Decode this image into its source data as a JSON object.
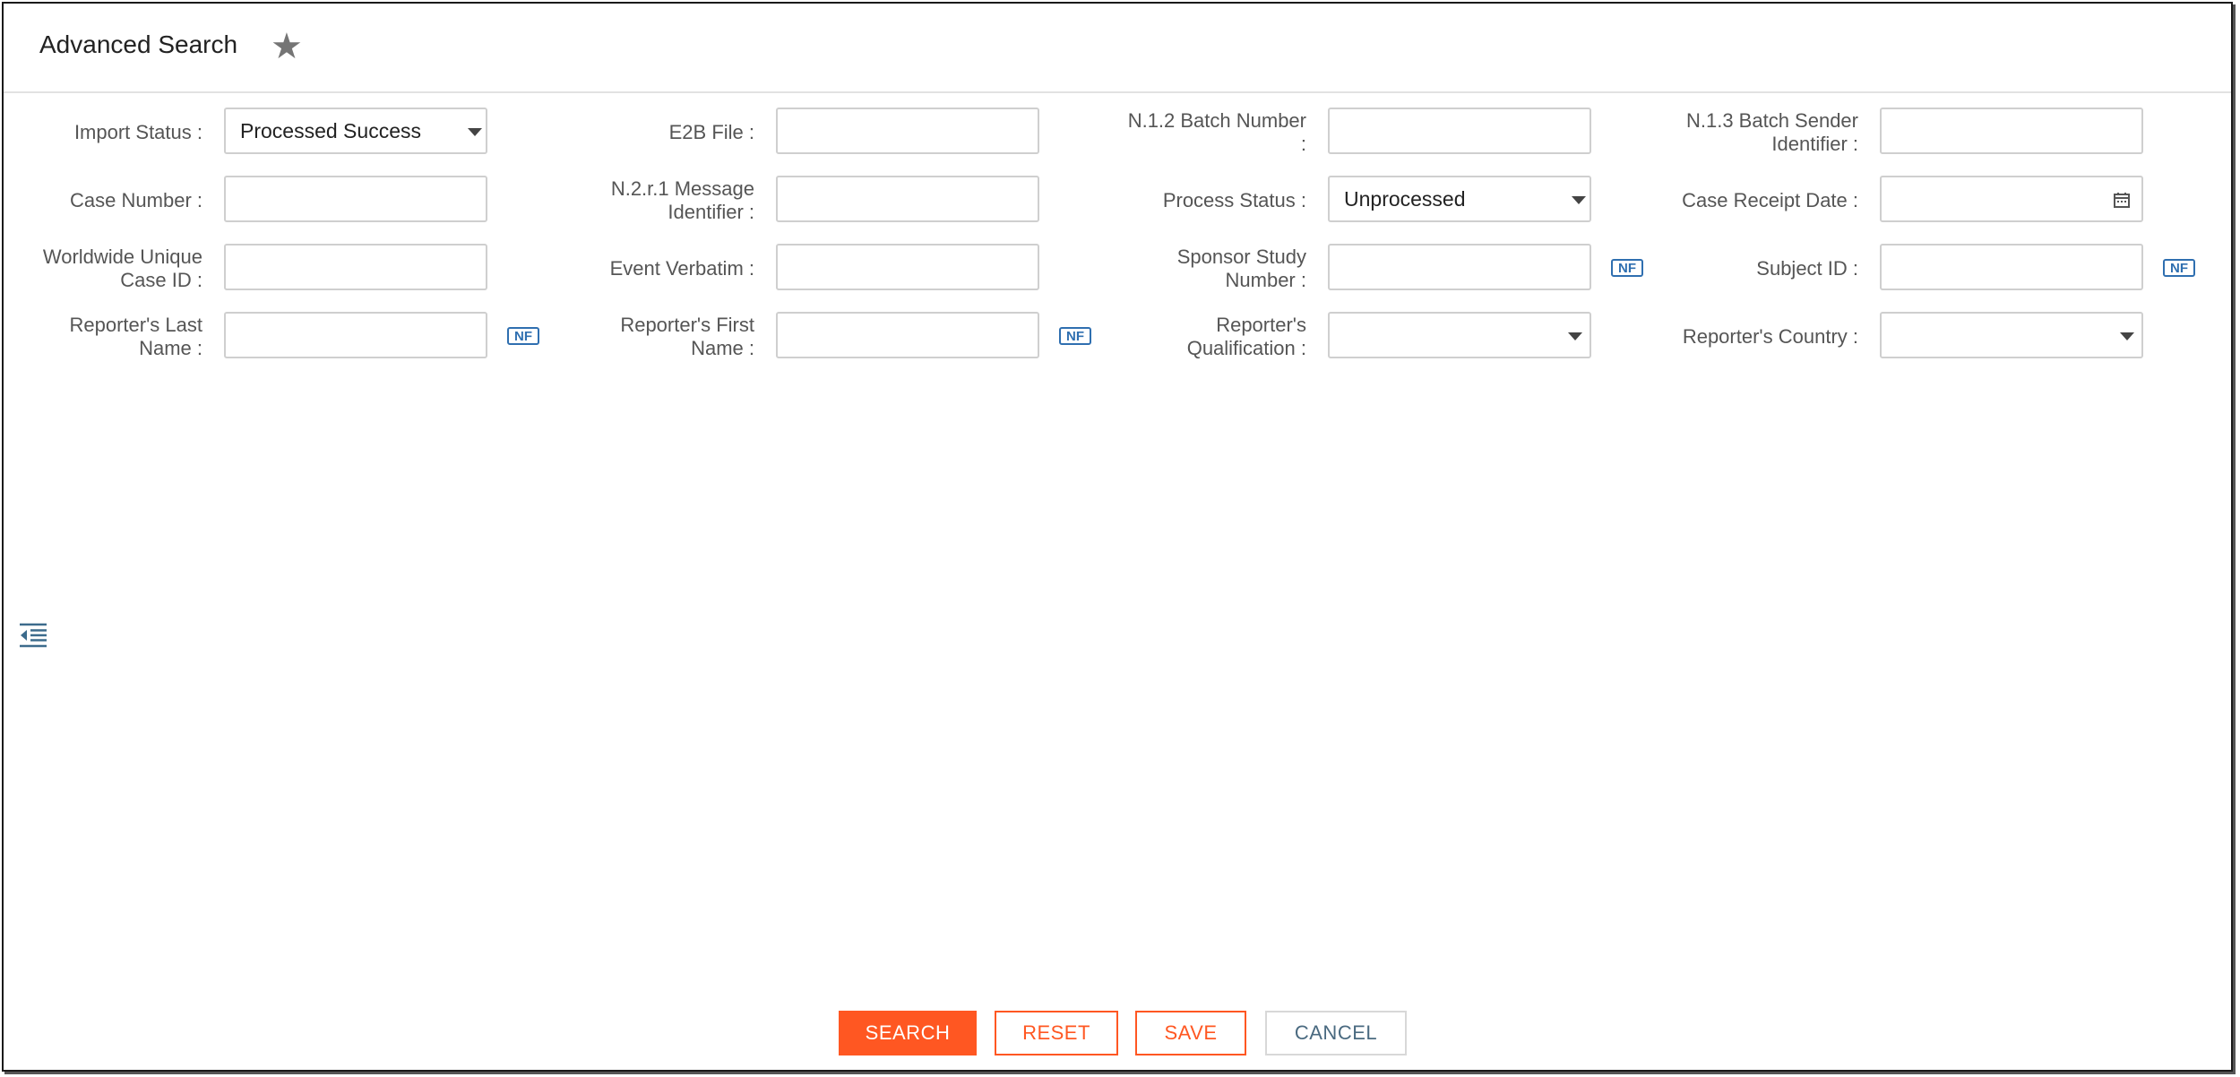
{
  "header": {
    "title": "Advanced Search",
    "star_icon": "star-icon"
  },
  "fields": {
    "import_status": {
      "label": "Import Status :",
      "value": "Processed Success"
    },
    "e2b_file": {
      "label": "E2B File :",
      "value": ""
    },
    "n12_batch": {
      "label": "N.1.2 Batch Number :",
      "value": ""
    },
    "n13_batch": {
      "label": "N.1.3 Batch Sender Identifier :",
      "value": ""
    },
    "case_number": {
      "label": "Case Number :",
      "value": ""
    },
    "n2r1_message": {
      "label": "N.2.r.1 Message Identifier :",
      "value": ""
    },
    "process_status": {
      "label": "Process Status :",
      "value": "Unprocessed"
    },
    "case_receipt_date": {
      "label": "Case Receipt Date :",
      "value": ""
    },
    "worldwide_case_id": {
      "label": "Worldwide Unique Case ID :",
      "value": ""
    },
    "event_verbatim": {
      "label": "Event Verbatim :",
      "value": ""
    },
    "sponsor_study_number": {
      "label": "Sponsor Study Number :",
      "value": ""
    },
    "subject_id": {
      "label": "Subject ID :",
      "value": ""
    },
    "reporter_last_name": {
      "label": "Reporter's Last Name :",
      "value": ""
    },
    "reporter_first_name": {
      "label": "Reporter's First Name :",
      "value": ""
    },
    "reporter_qualification": {
      "label": "Reporter's Qualification :",
      "value": ""
    },
    "reporter_country": {
      "label": "Reporter's Country :",
      "value": ""
    }
  },
  "nf_badge": "NF",
  "buttons": {
    "search": "SEARCH",
    "reset": "RESET",
    "save": "SAVE",
    "cancel": "CANCEL"
  },
  "colors": {
    "accent": "#ff5722",
    "nf_blue": "#2f6fb0"
  }
}
